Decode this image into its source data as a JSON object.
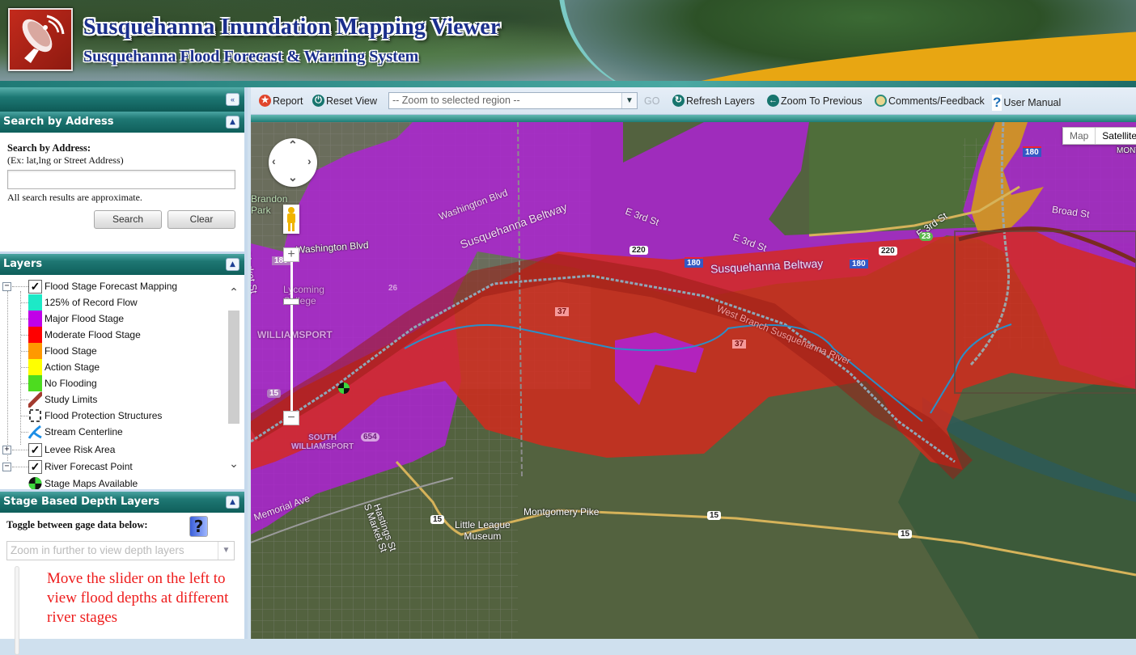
{
  "header": {
    "title": "Susquehanna Inundation Mapping Viewer",
    "subtitle": "Susquehanna Flood Forecast & Warning System",
    "logo_icon": "satellite-dish-icon"
  },
  "sidebar": {
    "collapse_icon": "double-chevron-left-icon",
    "search": {
      "panel_title": "Search by Address",
      "label": "Search by Address:",
      "hint": "(Ex: lat,lng or Street Address)",
      "input_value": "",
      "note": "All search results are approximate.",
      "search_button": "Search",
      "clear_button": "Clear"
    },
    "layers": {
      "panel_title": "Layers",
      "items": [
        {
          "label": "Flood Stage Forecast Mapping",
          "type": "group",
          "checked": true,
          "expanded": true
        },
        {
          "label": "125% of Record Flow",
          "type": "legend",
          "color": "#1de9c7"
        },
        {
          "label": "Major Flood Stage",
          "type": "legend",
          "color": "#c000e8"
        },
        {
          "label": "Moderate Flood Stage",
          "type": "legend",
          "color": "#ff0000"
        },
        {
          "label": "Flood Stage",
          "type": "legend",
          "color": "#ff9900"
        },
        {
          "label": "Action Stage",
          "type": "legend",
          "color": "#ffff00"
        },
        {
          "label": "No Flooding",
          "type": "legend",
          "color": "#4ddc1f"
        },
        {
          "label": "Study Limits",
          "type": "legend-icon",
          "icon": "study-limits-line-icon"
        },
        {
          "label": "Flood Protection Structures",
          "type": "legend-icon",
          "icon": "dashed-box-icon"
        },
        {
          "label": "Stream Centerline",
          "type": "legend-icon",
          "icon": "stream-line-icon"
        },
        {
          "label": "Levee Risk Area",
          "type": "group",
          "checked": true,
          "expanded": false
        },
        {
          "label": "River Forecast Point",
          "type": "group",
          "checked": true,
          "expanded": true
        },
        {
          "label": "Stage Maps Available",
          "type": "legend-icon",
          "icon": "gage-point-icon"
        }
      ]
    },
    "depth": {
      "panel_title": "Stage Based Depth Layers",
      "toggle_label": "Toggle between gage data below:",
      "help_label": "?",
      "select_value": "Zoom in further to view depth layers",
      "message": "Move the slider on the left to view flood depths at different river stages"
    }
  },
  "toolbar": {
    "report": "Report",
    "reset_view": "Reset View",
    "region_select": "-- Zoom to selected region --",
    "go": "GO",
    "refresh_layers": "Refresh Layers",
    "zoom_previous": "Zoom To Previous",
    "comments": "Comments/Feedback",
    "user_manual": "User Manual"
  },
  "map": {
    "map_type_buttons": [
      "Map",
      "Satellite"
    ],
    "selected_type": "Satellite",
    "labels": [
      {
        "text": "Brandon Park",
        "kind": "park"
      },
      {
        "text": "Washington Blvd"
      },
      {
        "text": "Washington Blvd"
      },
      {
        "text": "Susquehanna Beltway"
      },
      {
        "text": "Susquehanna Beltway"
      },
      {
        "text": "E 3rd St"
      },
      {
        "text": "E 3rd St"
      },
      {
        "text": "E 3rd St"
      },
      {
        "text": "Lycoming College"
      },
      {
        "text": "WILLIAMSPORT"
      },
      {
        "text": "SOUTH WILLIAMSPORT"
      },
      {
        "text": "West Branch Susquehanna River"
      },
      {
        "text": "Broad St"
      },
      {
        "text": "Montgomery Pike"
      },
      {
        "text": "Little League Museum"
      },
      {
        "text": "Hastings St"
      },
      {
        "text": "S Market St"
      },
      {
        "text": "Market St"
      },
      {
        "text": "Memorial Ave"
      },
      {
        "text": "MONT"
      }
    ],
    "shields": [
      "220",
      "180",
      "180",
      "220",
      "180",
      "23",
      "15",
      "15",
      "15",
      "15",
      "654",
      "37",
      "37",
      "26",
      "180"
    ]
  }
}
